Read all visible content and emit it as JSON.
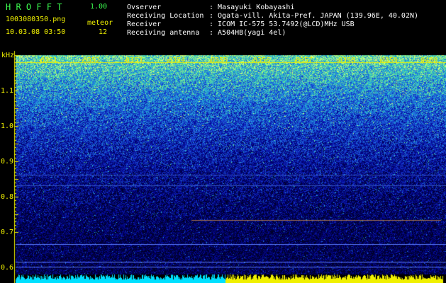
{
  "app": {
    "name": "H R O F F T",
    "version": "1.00"
  },
  "file": {
    "name": "1003080350.png",
    "timestamp": "10.03.08 03:50"
  },
  "meteor": {
    "label": "meteor",
    "count": "12"
  },
  "info": {
    "observer_label": "Ovserver",
    "observer_value": ": Masayuki Kobayashi",
    "location_label": "Receiving Location",
    "location_value": ": Ogata-vill. Akita-Pref. JAPAN (139.96E, 40.02N)",
    "receiver_label": "Receiver",
    "receiver_value": ": ICOM IC-575 53.7492(@LCD)MHz USB",
    "antenna_label": "Receiving antenna",
    "antenna_value": ": A504HB(yagi 4el)"
  },
  "axis": {
    "unit": "kHz",
    "freq_ticks": [
      "1.1",
      "1.0",
      "0.9",
      "0.8",
      "0.7",
      "0.6"
    ],
    "time_ticks": [
      "0351",
      "0352",
      "0353",
      "0354",
      "0355",
      "0356",
      "0357",
      "0358",
      "0359",
      "0400"
    ]
  },
  "colors": {
    "label": "#f0f000",
    "title": "#3cff50",
    "text": "#ffffff",
    "background": "#000000"
  }
}
